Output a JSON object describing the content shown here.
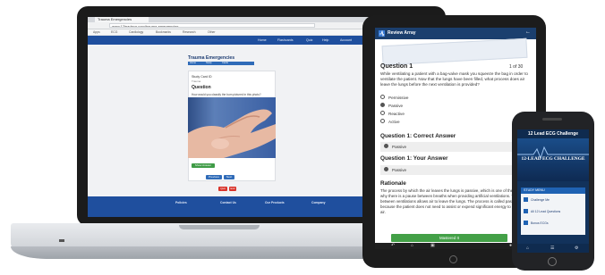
{
  "laptop": {
    "browser": {
      "tab_title": "Trauma Emergencies",
      "url": "www.12leadecg.com/trauma-emergencies",
      "bookmarks": [
        "Apps",
        "ECG",
        "Cardiology",
        "Bookmarks",
        "Research",
        "Other"
      ],
      "nav": [
        "Home",
        "Flashcards",
        "Quiz",
        "Help",
        "Account"
      ]
    },
    "page": {
      "title": "Trauma Emergencies",
      "breadcrumbs": [
        "Home",
        "Study",
        "Cards"
      ],
      "card_id": "Study Card ID",
      "card_sub": "Trauma",
      "question_heading": "Question",
      "question_prompt": "How would you classify the burn pictured in this photo?",
      "show_answer": "Show Answer",
      "prev": "Previous",
      "next": "Next",
      "btn_a": "Quit",
      "btn_b": "Exit"
    },
    "footer": [
      "Policies",
      "Contact Us",
      "Our Products",
      "Company"
    ]
  },
  "tablet": {
    "bar_title": "Review Array",
    "question_title": "Question 1",
    "count": "1 of 30",
    "question_text": "While ventilating a patient with a bag-valve mask you squeeze the bag in order to ventilate the patient. Now that the lungs have been filled, what process does air leave the lungs before the next ventilation is provided?",
    "options": [
      "Permissive",
      "Passive",
      "Reactive",
      "Active"
    ],
    "selected_option_index": 1,
    "correct_heading": "Question 1: Correct Answer",
    "correct_answer": "Passive",
    "your_heading": "Question 1: Your Answer",
    "your_answer": "Passive",
    "rationale_heading": "Rationale",
    "rationale_text": "The process by which the air leaves the lungs is passive, which is one of the reasons why there is a pause between breaths when providing artificial ventilations. Time between ventilations allows air to leave the lungs. The process is called passive because the patient does not need to assist or expend significant energy to expel the air.",
    "mastered_button": "Mastered It"
  },
  "phone": {
    "top_title": "12 Lead ECG Challenge",
    "hero_title": "12-LEAD ECG CHALLENGE",
    "menu_heading": "STUDY MENU",
    "menu_items": [
      "Challenge Me",
      "All 12 Lead Questions",
      "Bonus ECGs"
    ]
  },
  "colors": {
    "brand_blue": "#1f4f9e",
    "tablet_bar": "#1b3f6e",
    "mastered_green": "#43a047",
    "phone_bg": "#12325b",
    "danger_red": "#d9342b"
  }
}
